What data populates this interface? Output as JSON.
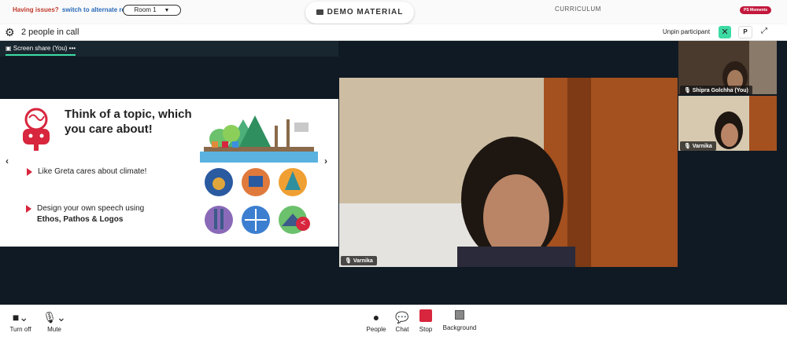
{
  "topbar": {
    "issues_text": "Having issues?",
    "alternate_link": "switch to alternate room",
    "room_select": "Room 1",
    "demo_material": "DEMO MATERIAL",
    "curriculum": "CURRICULUM",
    "moments_badge": "PS Moments"
  },
  "call": {
    "people_count": "2 people in call",
    "unpin_label": "Unpin participant",
    "p_button": "P"
  },
  "screen_share": {
    "label": "Screen share (You)",
    "more": "•••"
  },
  "slide": {
    "title": "Think of a topic, which you care about!",
    "bullet1": "Like Greta cares about climate!",
    "bullet2_prefix": "Design your own speech using",
    "bullet2_bold": "Ethos, Pathos & Logos"
  },
  "participants": {
    "main": "Varnika",
    "side1": "Shipra Golchha (You)",
    "side2": "Varnika"
  },
  "controls": {
    "camera": "Turn off",
    "mic": "Mute",
    "people": "People",
    "chat": "Chat",
    "stop": "Stop",
    "background": "Background"
  },
  "colors": {
    "accent": "#3ddba4",
    "stop": "#d7263d",
    "moments": "#c2183b",
    "stage": "#0f1a24"
  }
}
